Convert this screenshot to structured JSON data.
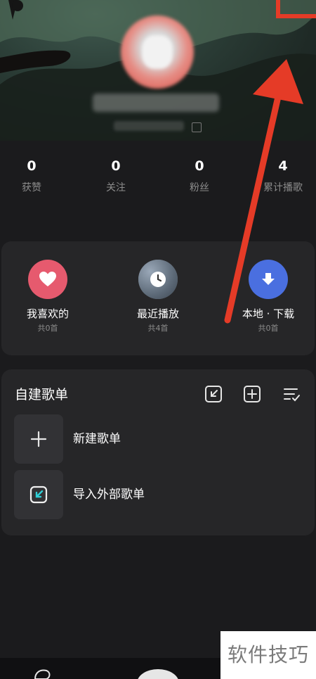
{
  "stats": [
    {
      "value": "0",
      "label": "获赞"
    },
    {
      "value": "0",
      "label": "关注"
    },
    {
      "value": "0",
      "label": "粉丝"
    },
    {
      "value": "4",
      "label": "累计播歌"
    }
  ],
  "quick_access": [
    {
      "label": "我喜欢的",
      "count": "共0首",
      "icon": "heart-icon",
      "color": "#e65a6e"
    },
    {
      "label": "最近播放",
      "count": "共4首",
      "icon": "clock-icon",
      "color": "#6f7a86"
    },
    {
      "label": "本地 · 下载",
      "count": "共0首",
      "icon": "download-icon",
      "color": "#4a6fe0"
    }
  ],
  "playlists": {
    "title": "自建歌单",
    "tools": [
      "import-icon",
      "add-box-icon",
      "sort-list-icon"
    ],
    "items": [
      {
        "name": "新建歌单",
        "icon": "plus-icon"
      },
      {
        "name": "导入外部歌单",
        "icon": "import-icon"
      }
    ]
  },
  "watermark": "软件技巧",
  "colors": {
    "accent_arrow": "#e53b27",
    "card_bg": "#262628",
    "page_bg": "#1b1b1d"
  }
}
